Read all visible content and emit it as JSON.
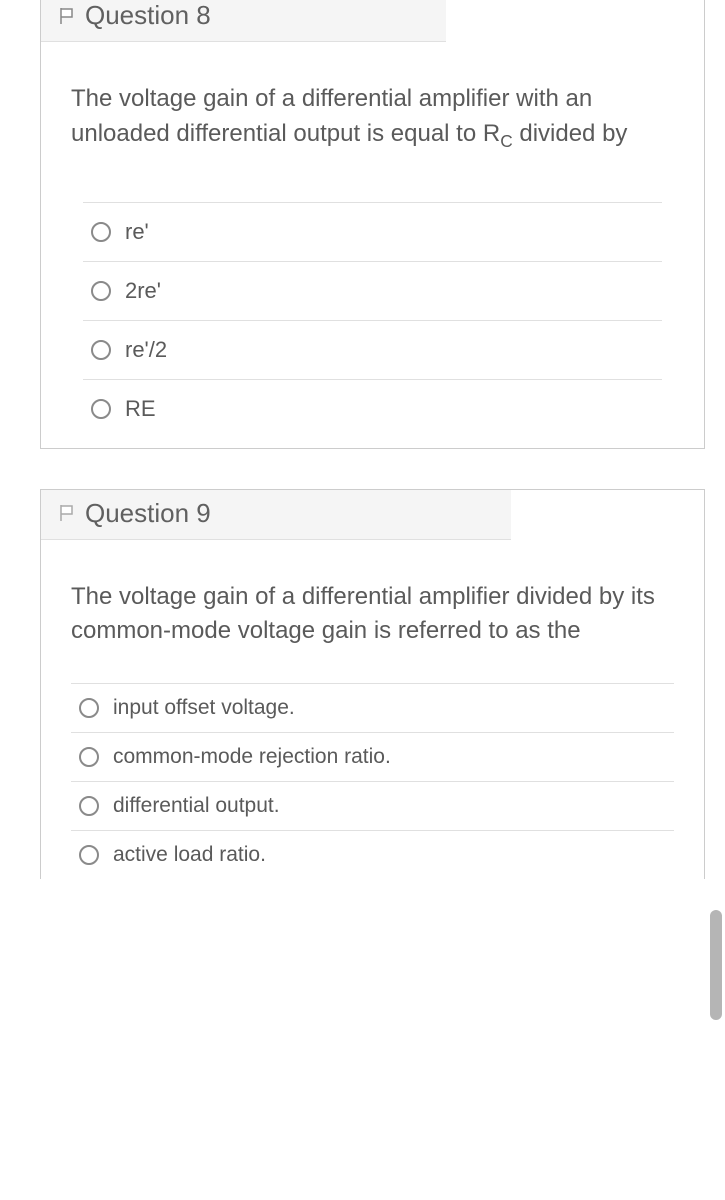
{
  "questions": [
    {
      "title": "Question 8",
      "text_pre": "The voltage gain of a differential amplifier with an unloaded differential output is equal to R",
      "text_sub": "C",
      "text_post": " divided by",
      "options": [
        {
          "label": "re'"
        },
        {
          "label": "2re'"
        },
        {
          "label": "re'/2"
        },
        {
          "label": "RE"
        }
      ]
    },
    {
      "title": "Question 9",
      "text_pre": "The voltage gain of a differential amplifier divided by its common-mode voltage gain is referred to as the",
      "text_sub": "",
      "text_post": "",
      "options": [
        {
          "label": "input offset voltage."
        },
        {
          "label": "common-mode rejection ratio."
        },
        {
          "label": "differential output."
        },
        {
          "label": "active load ratio."
        }
      ]
    }
  ]
}
